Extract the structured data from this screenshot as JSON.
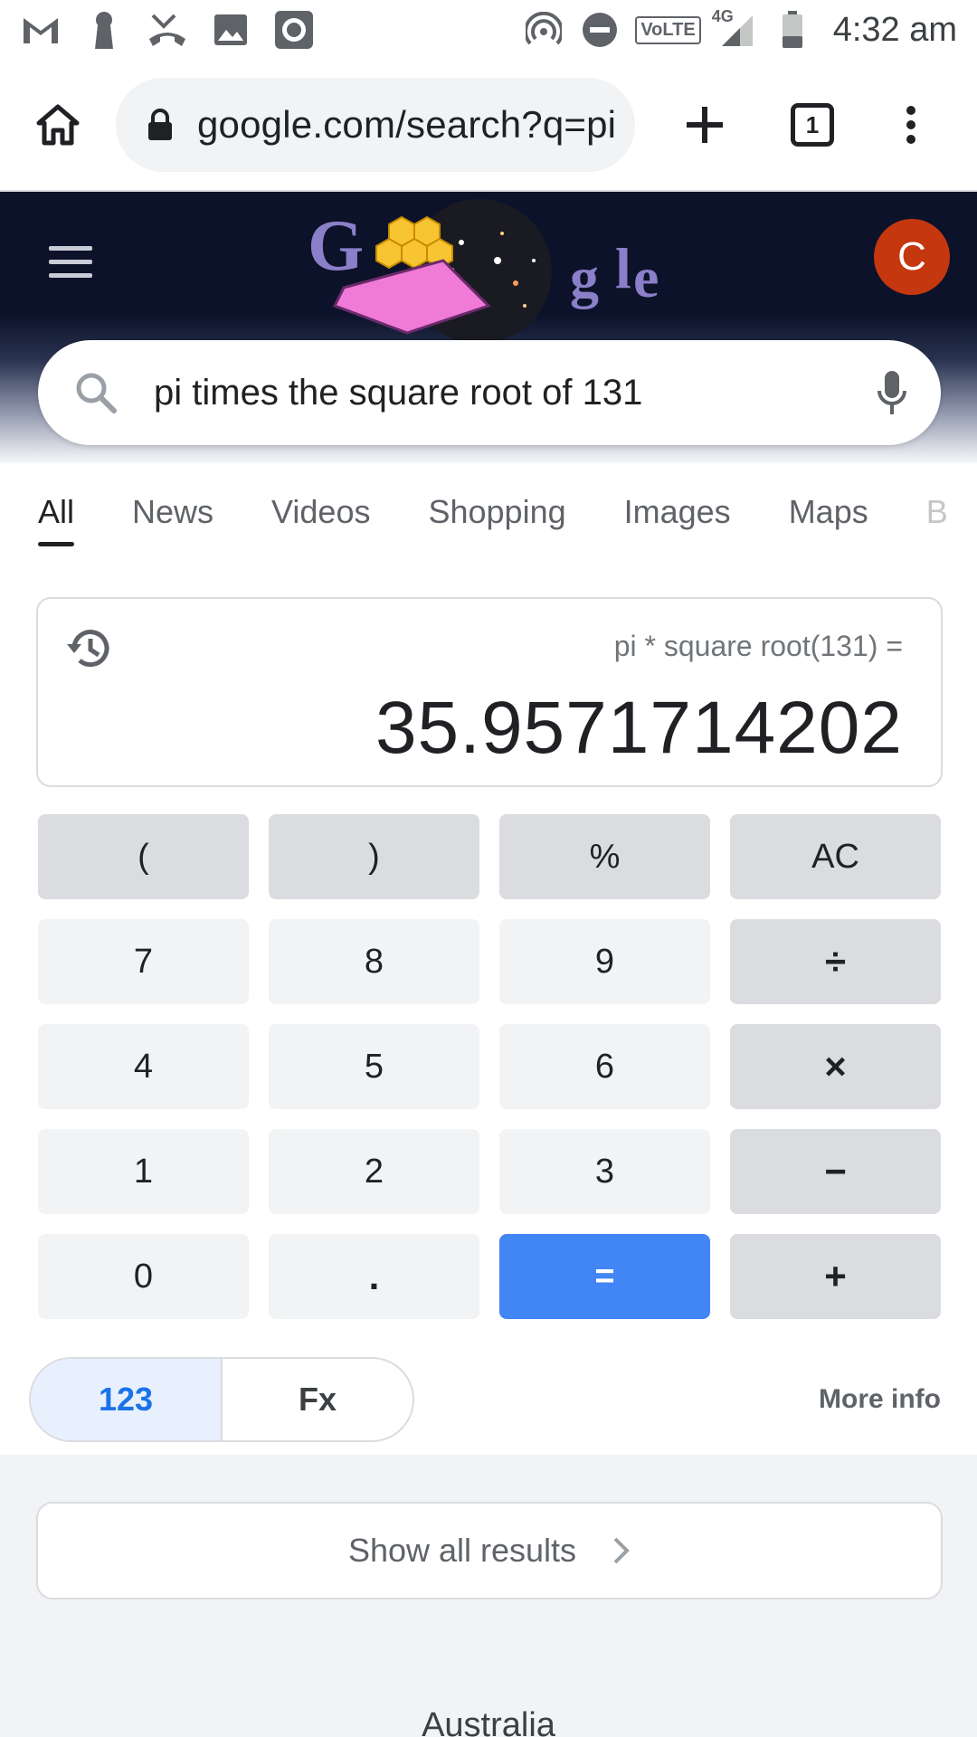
{
  "status_bar": {
    "time": "4:32 am",
    "network_badge": "VoLTE",
    "network_type": "4G",
    "left_icons": [
      "gmail-icon",
      "keyhole-icon",
      "missed-call-icon",
      "image-icon",
      "camera-icon"
    ],
    "right_icons": [
      "hotspot-icon",
      "dnd-icon",
      "signal-icon",
      "battery-icon"
    ]
  },
  "browser": {
    "url": "google.com/search?q=pi",
    "tab_count": "1"
  },
  "search": {
    "query": "pi times the square root of 131",
    "avatar_letter": "C"
  },
  "tabs": [
    {
      "label": "All",
      "active": true
    },
    {
      "label": "News"
    },
    {
      "label": "Videos"
    },
    {
      "label": "Shopping"
    },
    {
      "label": "Images"
    },
    {
      "label": "Maps"
    },
    {
      "label": "B"
    }
  ],
  "calculator": {
    "expression": "pi * square root(131) =",
    "result": "35.9571714202",
    "keys": [
      [
        "(",
        ")",
        "%",
        "AC"
      ],
      [
        "7",
        "8",
        "9",
        "÷"
      ],
      [
        "4",
        "5",
        "6",
        "×"
      ],
      [
        "1",
        "2",
        "3",
        "−"
      ],
      [
        "0",
        ".",
        "=",
        "+"
      ]
    ],
    "mode_basic": "123",
    "mode_fx": "Fx",
    "more_info": "More info"
  },
  "show_all_results": "Show all results",
  "region_label": "Australia",
  "colors": {
    "accent": "#4285f4",
    "avatar": "#c5370f",
    "header_bg": "#0b1229"
  }
}
